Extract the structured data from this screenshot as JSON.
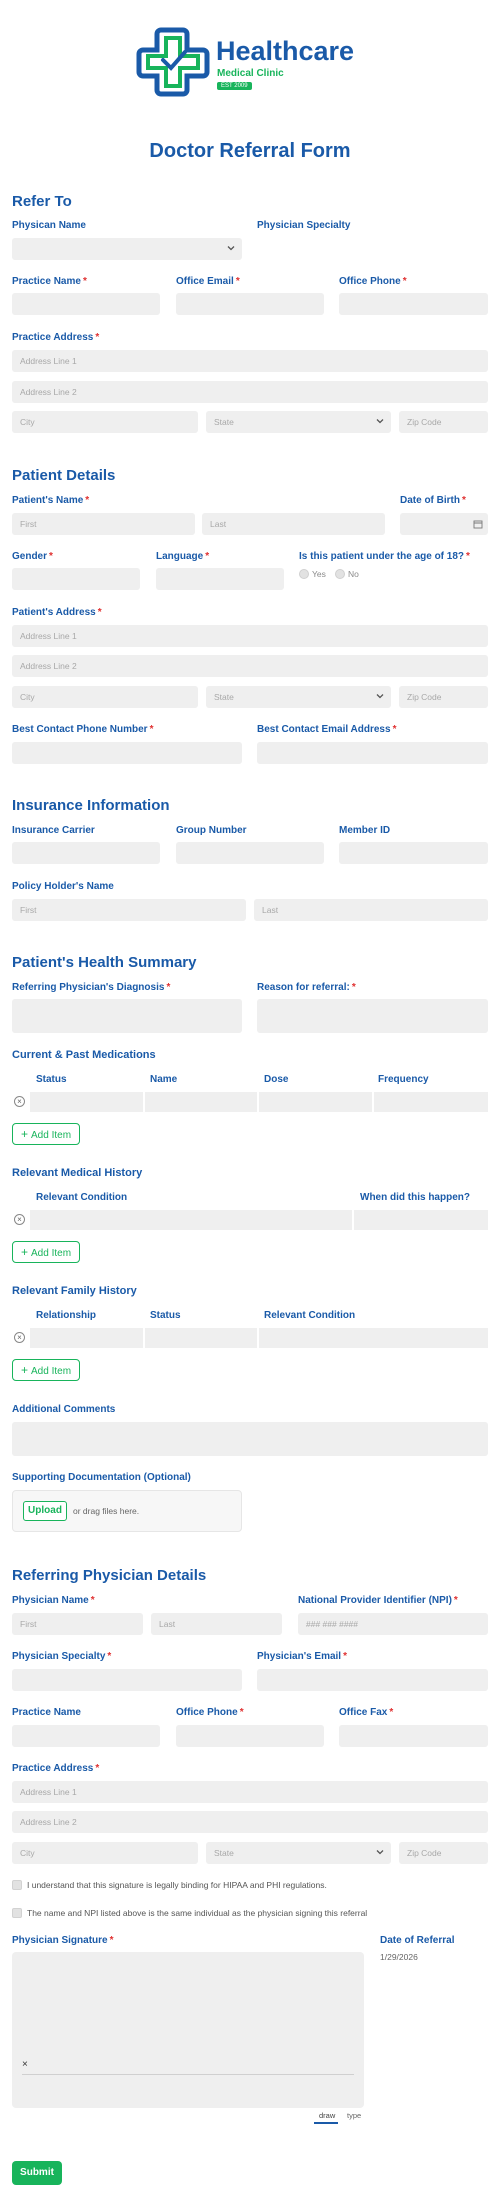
{
  "logo": {
    "name": "Healthcare",
    "sub": "Medical Clinic",
    "badge": "EST 2009"
  },
  "form_title": "Doctor Referral Form",
  "refer_to": {
    "heading": "Refer To",
    "physician_name": "Physican Name",
    "physician_specialty": "Physician Specialty",
    "practice_name": "Practice Name",
    "office_email": "Office Email",
    "office_phone": "Office Phone",
    "practice_address": "Practice Address",
    "addr1": "Address Line 1",
    "addr2": "Address Line 2",
    "city": "City",
    "state": "State",
    "zip": "Zip Code"
  },
  "patient": {
    "heading": "Patient Details",
    "name": "Patient's Name",
    "first": "First",
    "last": "Last",
    "dob": "Date of Birth",
    "gender": "Gender",
    "language": "Language",
    "under18": "Is this patient under the age of 18?",
    "yes": "Yes",
    "no": "No",
    "address": "Patient's Address",
    "addr1": "Address Line 1",
    "addr2": "Address Line 2",
    "city": "City",
    "state": "State",
    "zip": "Zip Code",
    "phone": "Best Contact Phone Number",
    "email": "Best Contact Email Address"
  },
  "insurance": {
    "heading": "Insurance Information",
    "carrier": "Insurance Carrier",
    "group": "Group Number",
    "member": "Member ID",
    "holder": "Policy Holder's Name",
    "first": "First",
    "last": "Last"
  },
  "health": {
    "heading": "Patient's Health Summary",
    "diagnosis": "Referring Physician's Diagnosis",
    "reason": "Reason for referral:",
    "meds": {
      "heading": "Current & Past Medications",
      "cols": [
        "Status",
        "Name",
        "Dose",
        "Frequency"
      ],
      "add": "Add Item"
    },
    "history": {
      "heading": "Relevant Medical History",
      "cols": [
        "Relevant Condition",
        "When did this happen?"
      ],
      "add": "Add Item"
    },
    "family": {
      "heading": "Relevant Family History",
      "cols": [
        "Relationship",
        "Status",
        "Relevant Condition"
      ],
      "add": "Add Item"
    },
    "comments": "Additional Comments",
    "docs": "Supporting Documentation (Optional)",
    "upload": "Upload",
    "drag": "or drag files here."
  },
  "referring": {
    "heading": "Referring Physician Details",
    "name": "Physician Name",
    "first": "First",
    "last": "Last",
    "npi": "National Provider Identifier (NPI)",
    "npi_ph": "### ### ####",
    "specialty": "Physician Specialty",
    "email": "Physician's Email",
    "practice": "Practice Name",
    "phone": "Office Phone",
    "fax": "Office Fax",
    "address": "Practice Address",
    "addr1": "Address Line 1",
    "addr2": "Address Line 2",
    "city": "City",
    "state": "State",
    "zip": "Zip Code",
    "consent1": "I understand that this signature is legally binding for HIPAA and PHI regulations.",
    "consent2": "The name and NPI listed above is the same individual as the physician signing this referral",
    "signature": "Physician Signature",
    "sig_x": "×",
    "date_label": "Date of Referral",
    "date_value": "1/29/2026",
    "draw": "draw",
    "type": "type",
    "submit": "Submit"
  },
  "colors": {
    "primary": "#1a5aa8",
    "accent": "#18b45b",
    "field": "#efefef",
    "required": "#e03030"
  }
}
